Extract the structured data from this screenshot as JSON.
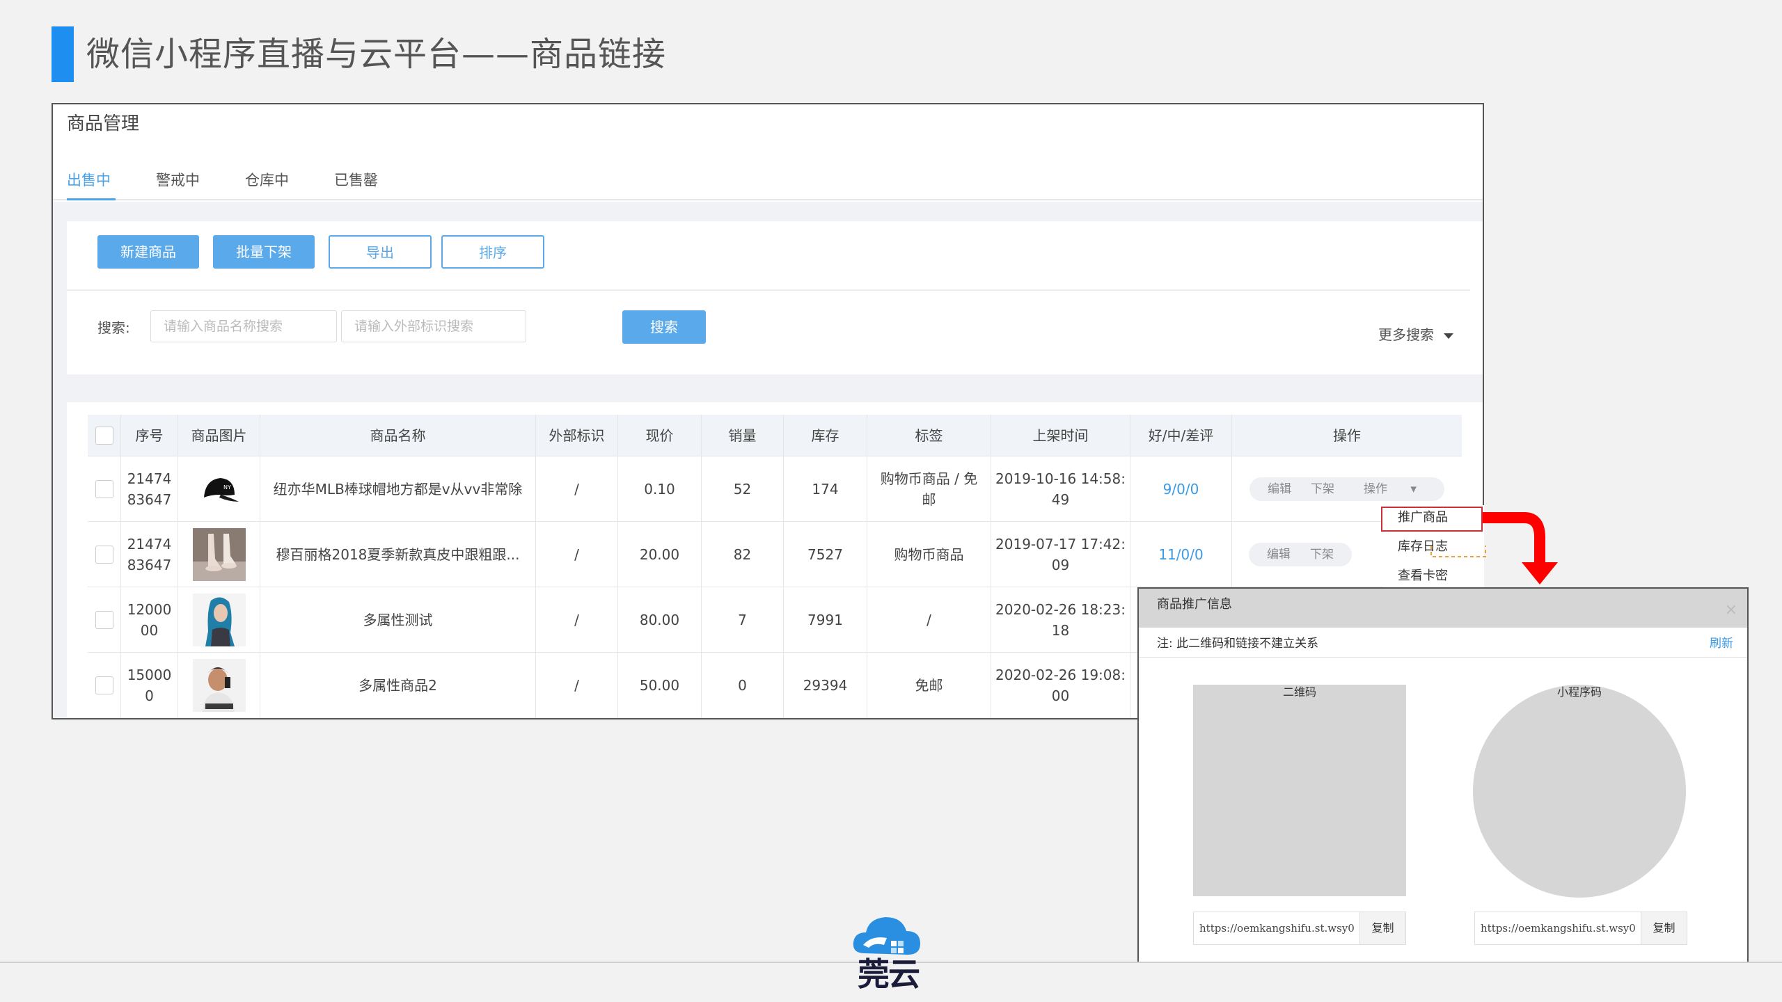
{
  "slide": {
    "title": "微信小程序直播与云平台——商品链接"
  },
  "panel": {
    "title": "商品管理",
    "tabs": [
      "出售中",
      "警戒中",
      "仓库中",
      "已售罄"
    ],
    "actions": {
      "new": "新建商品",
      "batch_off": "批量下架",
      "export": "导出",
      "sort": "排序"
    },
    "search": {
      "label": "搜索:",
      "name_placeholder": "请输入商品名称搜索",
      "ext_placeholder": "请输入外部标识搜索",
      "button": "搜索",
      "more": "更多搜索"
    },
    "table": {
      "headers": [
        "序号",
        "商品图片",
        "商品名称",
        "外部标识",
        "现价",
        "销量",
        "库存",
        "标签",
        "上架时间",
        "好/中/差评",
        "操作"
      ],
      "rows": [
        {
          "id": "2147483647",
          "image": "cap",
          "name": "纽亦华MLB棒球帽地方都是v从vv非常除",
          "ext": "/",
          "price": "0.10",
          "sales": "52",
          "stock": "174",
          "tag": "购物币商品 / 免邮",
          "time": "2019-10-16 14:58:49",
          "rating": "9/0/0"
        },
        {
          "id": "2147483647",
          "image": "shoes",
          "name": "穆百丽格2018夏季新款真皮中跟粗跟...",
          "ext": "/",
          "price": "20.00",
          "sales": "82",
          "stock": "7527",
          "tag": "购物币商品",
          "time": "2019-07-17 17:42:09",
          "rating": "11/0/0"
        },
        {
          "id": "1200000",
          "image": "person-blue",
          "name": "多属性测试",
          "ext": "/",
          "price": "80.00",
          "sales": "7",
          "stock": "7991",
          "tag": "/",
          "time": "2020-02-26 18:23:18",
          "rating": ""
        },
        {
          "id": "1500000",
          "image": "person-phone",
          "name": "多属性商品2",
          "ext": "/",
          "price": "50.00",
          "sales": "0",
          "stock": "29394",
          "tag": "免邮",
          "time": "2020-02-26 19:08:00",
          "rating": ""
        }
      ],
      "row_ops": {
        "edit": "编辑",
        "off": "下架",
        "more": "操作"
      },
      "id_lines": [
        [
          "21474",
          "83647"
        ],
        [
          "21474",
          "83647"
        ],
        [
          "12000",
          "00"
        ],
        [
          "15000",
          "0"
        ]
      ],
      "tag_lines": [
        [
          "购物币商品 / 免",
          "邮"
        ],
        [
          "购物币商品"
        ],
        [
          "/"
        ],
        [
          "免邮"
        ]
      ],
      "time_lines": [
        [
          "2019-10-16 14:58:",
          "49"
        ],
        [
          "2019-07-17 17:42:",
          "09"
        ],
        [
          "2020-02-26 18:23:",
          "18"
        ],
        [
          "2020-02-26 19:08:",
          "00"
        ]
      ]
    },
    "dropdown": [
      "推广商品",
      "库存日志",
      "查看卡密"
    ]
  },
  "popup": {
    "title": "商品推广信息",
    "close": "×",
    "note": "注: 此二维码和链接不建立关系",
    "refresh": "刷新",
    "qr_label": "二维码",
    "mp_label": "小程序码",
    "qr_url": "https://oemkangshifu.st.wsy0",
    "mp_url": "https://oemkangshifu.st.wsy0",
    "copy": "复制"
  },
  "footer": {
    "logo_text": "莞云"
  },
  "colors": {
    "accent": "#1f8ef1",
    "primary_btn": "#5aa9ea",
    "link": "#3a9ae6",
    "highlight": "#c9303a",
    "arrow": "#ff0000"
  }
}
